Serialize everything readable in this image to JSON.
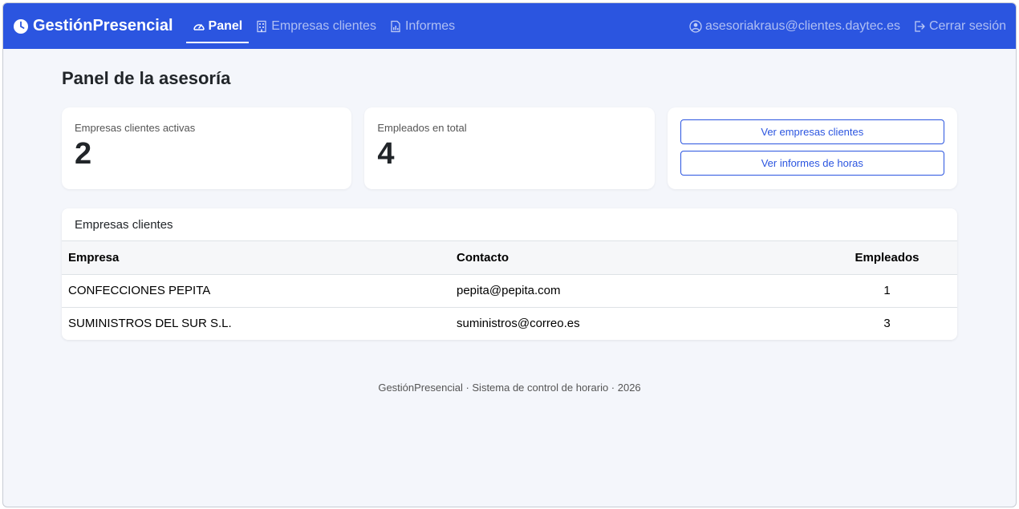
{
  "navbar": {
    "brand": "GestiónPresencial",
    "items": [
      {
        "label": "Panel",
        "icon": "speedometer-icon",
        "active": true
      },
      {
        "label": "Empresas clientes",
        "icon": "building-icon",
        "active": false
      },
      {
        "label": "Informes",
        "icon": "report-icon",
        "active": false
      }
    ],
    "user_email": "asesoriakraus@clientes.daytec.es",
    "logout_label": "Cerrar sesión"
  },
  "page": {
    "title": "Panel de la asesoría"
  },
  "stats": {
    "active_clients_label": "Empresas clientes activas",
    "active_clients_value": "2",
    "employees_label": "Empleados en total",
    "employees_value": "4"
  },
  "actions": {
    "view_clients": "Ver empresas clientes",
    "view_reports": "Ver informes de horas"
  },
  "clients_table": {
    "title": "Empresas clientes",
    "headers": {
      "company": "Empresa",
      "contact": "Contacto",
      "employees": "Empleados"
    },
    "rows": [
      {
        "company": "CONFECCIONES PEPITA",
        "contact": "pepita@pepita.com",
        "employees": "1"
      },
      {
        "company": "SUMINISTROS DEL SUR S.L.",
        "contact": "suministros@correo.es",
        "employees": "3"
      }
    ]
  },
  "footer": {
    "text": "GestiónPresencial · Sistema de control de horario · 2026"
  },
  "colors": {
    "primary": "#2b55e0",
    "background": "#f4f6fb"
  }
}
